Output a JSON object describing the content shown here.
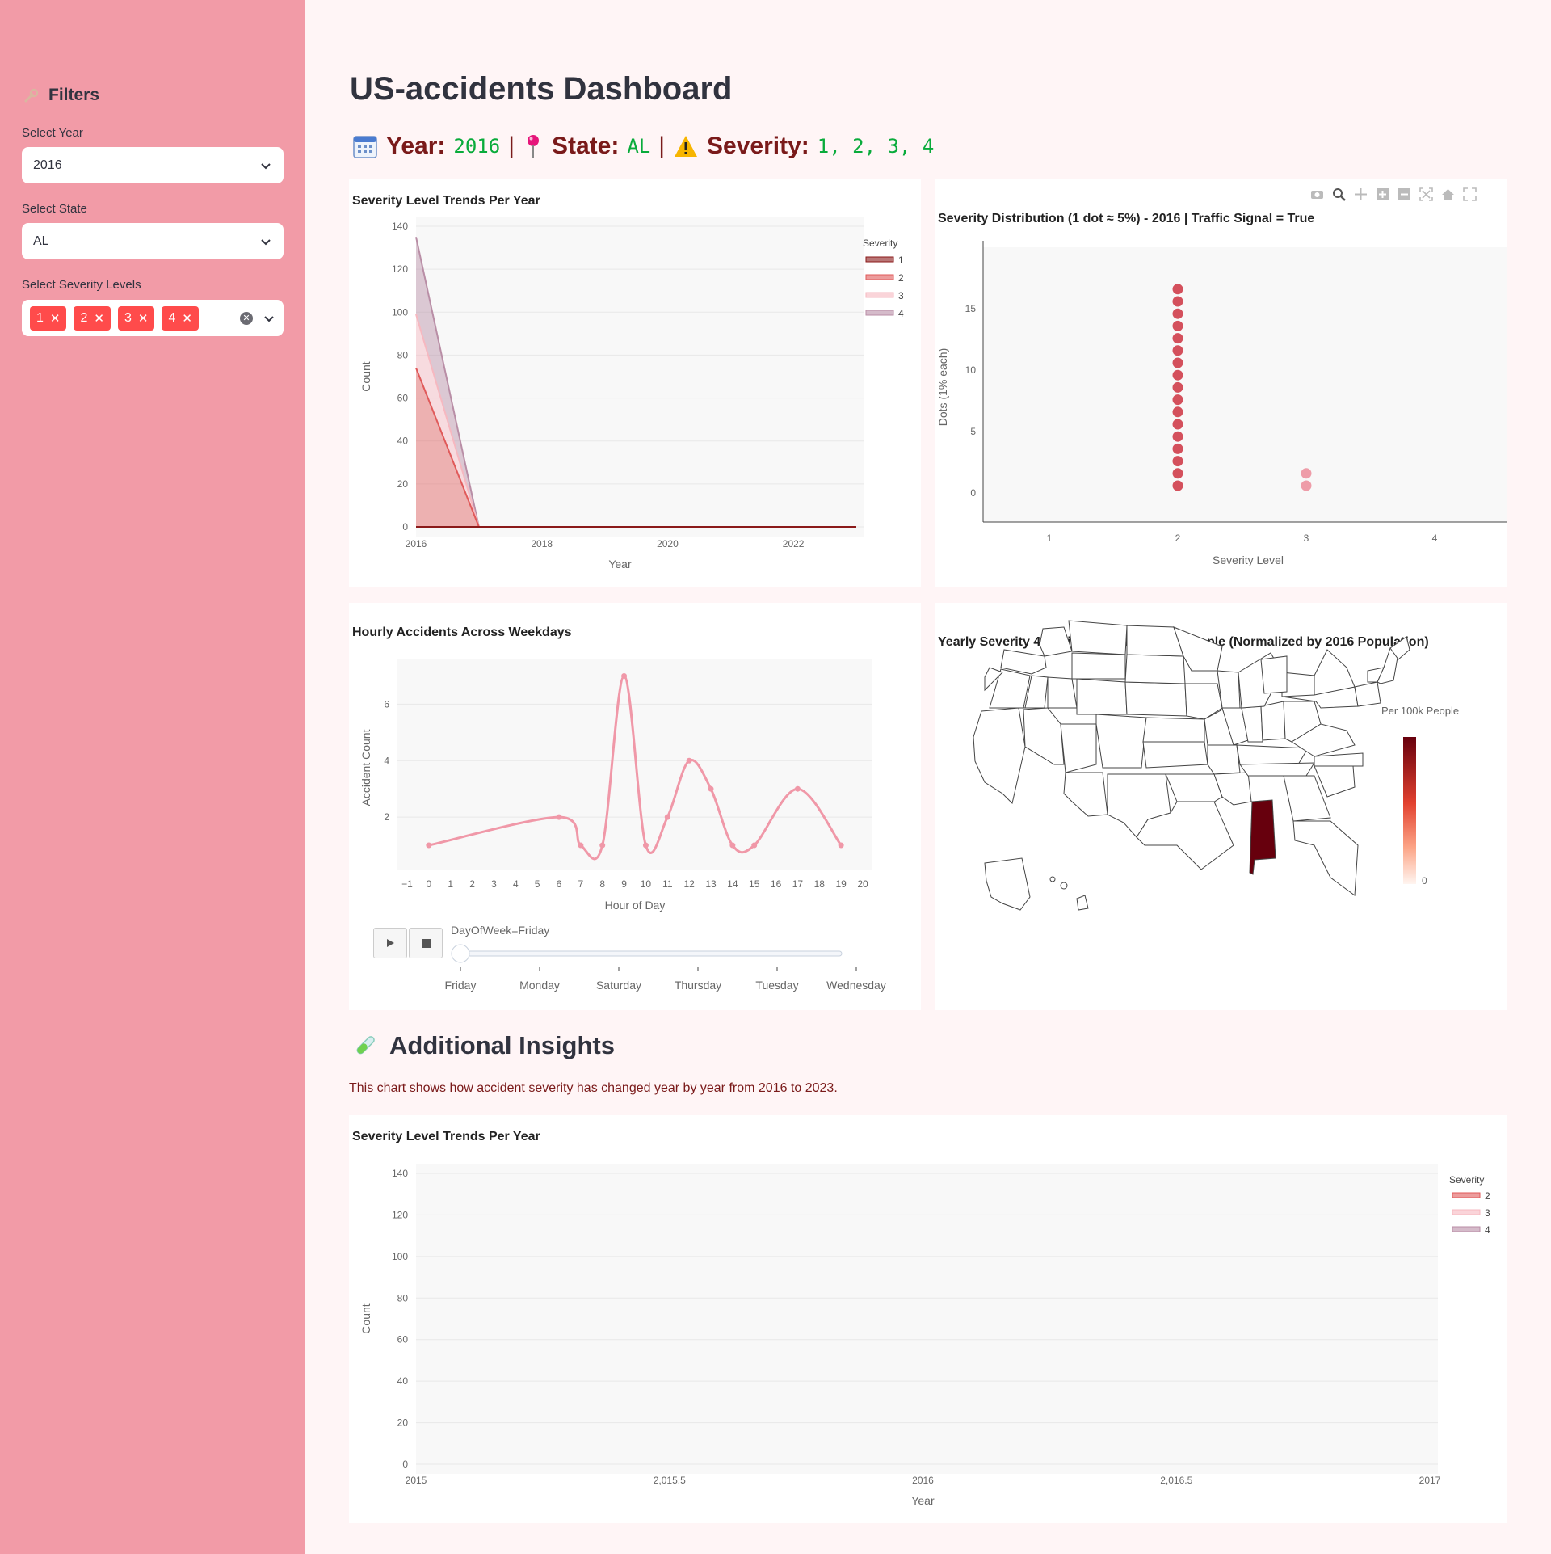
{
  "sidebar": {
    "title": "Filters",
    "year_label": "Select Year",
    "year_value": "2016",
    "state_label": "Select State",
    "state_value": "AL",
    "severity_label": "Select Severity Levels",
    "severity_tags": [
      "1",
      "2",
      "3",
      "4"
    ]
  },
  "header": {
    "title": "US-accidents Dashboard",
    "year_label": "Year:",
    "year_value": "2016",
    "state_label": "State:",
    "state_value": "AL",
    "severity_label": "Severity:",
    "severity_value": "1, 2, 3, 4",
    "sep": "|"
  },
  "insights": {
    "title": "Additional Insights",
    "text": "This chart shows how accident severity has changed year by year from 2016 to 2023."
  },
  "colors": {
    "sidebar": "#f29ba7",
    "accent": "#ff4b4b",
    "sev1": "#8b1a1a",
    "sev2": "#e05a5a",
    "sev3": "#f6b8c0",
    "sev4": "#b98ea6",
    "dots": "#d4505c",
    "line": "#f098a8",
    "map_dark": "#67000d"
  },
  "chart_data": [
    {
      "type": "area",
      "title": "Severity Level Trends Per Year",
      "xlabel": "Year",
      "ylabel": "Count",
      "x_ticks": [
        "2016",
        "2018",
        "2020",
        "2022"
      ],
      "y_ticks": [
        "0",
        "20",
        "40",
        "60",
        "80",
        "100",
        "120",
        "140"
      ],
      "xlim": [
        2016,
        2023
      ],
      "ylim": [
        0,
        140
      ],
      "x": [
        2016,
        2017,
        2018,
        2019,
        2020,
        2021,
        2022,
        2023
      ],
      "legend_title": "Severity",
      "series": [
        {
          "name": "1",
          "values": [
            0,
            0,
            0,
            0,
            0,
            0,
            0,
            0
          ]
        },
        {
          "name": "2",
          "values": [
            74,
            0,
            0,
            0,
            0,
            0,
            0,
            0
          ]
        },
        {
          "name": "3",
          "values": [
            25,
            0,
            0,
            0,
            0,
            0,
            0,
            0
          ]
        },
        {
          "name": "4",
          "values": [
            36,
            0,
            0,
            0,
            0,
            0,
            0,
            0
          ]
        }
      ]
    },
    {
      "type": "scatter",
      "title": "Severity Distribution (1 dot ≈ 5%) - 2016 | Traffic Signal = True",
      "xlabel": "Severity Level",
      "ylabel": "Dots (1% each)",
      "x_ticks": [
        "1",
        "2",
        "3",
        "4"
      ],
      "y_ticks": [
        "0",
        "5",
        "10",
        "15"
      ],
      "xlim": [
        0.5,
        4.5
      ],
      "ylim": [
        -1,
        19
      ],
      "series": [
        {
          "x": 2,
          "count": 17
        },
        {
          "x": 3,
          "count": 2
        }
      ]
    },
    {
      "type": "line",
      "title": "Hourly Accidents Across Weekdays",
      "xlabel": "Hour of Day",
      "ylabel": "Accident Count",
      "x_ticks": [
        "−1",
        "0",
        "1",
        "2",
        "3",
        "4",
        "5",
        "6",
        "7",
        "8",
        "9",
        "10",
        "11",
        "12",
        "13",
        "14",
        "15",
        "16",
        "17",
        "18",
        "19",
        "20"
      ],
      "y_ticks": [
        "2",
        "4",
        "6"
      ],
      "xlim": [
        -1,
        20
      ],
      "ylim": [
        0.2,
        7.3
      ],
      "x": [
        0,
        6,
        7,
        8,
        9,
        10,
        11,
        12,
        13,
        14,
        15,
        17,
        19
      ],
      "values": [
        1,
        2,
        1,
        1,
        7,
        1,
        2,
        4,
        3,
        1,
        1,
        3,
        1
      ],
      "slider_label": "DayOfWeek=Friday",
      "slider_steps": [
        "Friday",
        "Monday",
        "Saturday",
        "Thursday",
        "Tuesday",
        "Wednesday"
      ]
    },
    {
      "type": "heatmap",
      "title": "Yearly Severity 4 Accidents per 100,000 People (Normalized by 2016 Population)",
      "colorbar_title": "Per 100k People",
      "colorbar_min": "0",
      "highlighted_state": "AL"
    },
    {
      "type": "area",
      "title": "Severity Level Trends Per Year",
      "xlabel": "Year",
      "ylabel": "Count",
      "x_ticks": [
        "2015",
        "2,015.5",
        "2016",
        "2,016.5",
        "2017"
      ],
      "y_ticks": [
        "0",
        "20",
        "40",
        "60",
        "80",
        "100",
        "120",
        "140"
      ],
      "xlim": [
        2015,
        2017
      ],
      "ylim": [
        0,
        140
      ],
      "legend_title": "Severity",
      "series": [
        {
          "name": "2",
          "values": []
        },
        {
          "name": "3",
          "values": []
        },
        {
          "name": "4",
          "values": []
        }
      ]
    }
  ]
}
